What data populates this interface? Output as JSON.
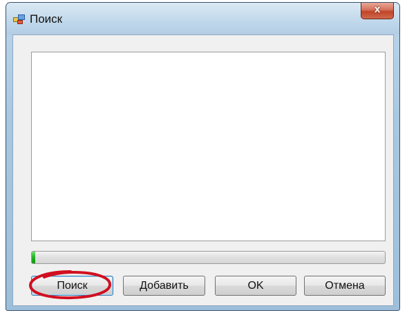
{
  "window": {
    "title": "Поиск",
    "close_label": "x"
  },
  "results_list": {
    "items": []
  },
  "progress": {
    "value_percent": 1,
    "color": "#22b022"
  },
  "buttons": {
    "search_label": "Поиск",
    "add_label": "Добавить",
    "ok_label": "OK",
    "cancel_label": "Отмена"
  },
  "annotation": {
    "color": "#d10f1f"
  }
}
